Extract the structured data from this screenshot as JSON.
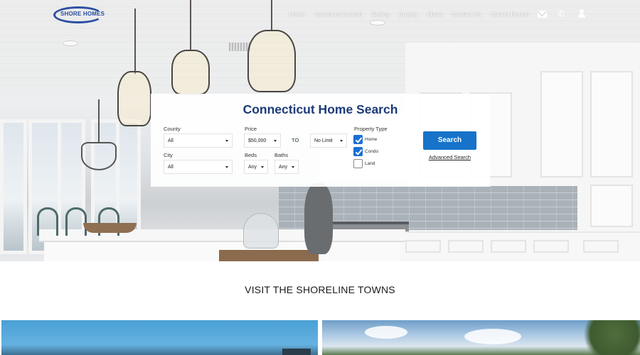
{
  "brand": {
    "logo_text": "SHORE HOMES",
    "accent": "#1c3a78",
    "button_color": "#1673c9"
  },
  "nav": {
    "items": [
      "Home",
      "Advanced Search",
      "Selling",
      "Buying",
      "About",
      "Contact Us",
      "Market Report"
    ],
    "icons": [
      "mail-icon",
      "phone-icon",
      "user-icon"
    ]
  },
  "search": {
    "title": "Connecticut Home Search",
    "county": {
      "label": "County",
      "value": "All"
    },
    "city": {
      "label": "City",
      "value": "All"
    },
    "price": {
      "label": "Price",
      "min_value": "$50,000",
      "to_label": "TO",
      "max_value": "No Limit"
    },
    "beds": {
      "label": "Beds",
      "value": "Any"
    },
    "baths": {
      "label": "Baths",
      "value": "Any"
    },
    "property_type": {
      "label": "Property Type",
      "options": [
        {
          "label": "Home",
          "checked": true
        },
        {
          "label": "Condo",
          "checked": true
        },
        {
          "label": "Land",
          "checked": false
        }
      ]
    },
    "search_button": "Search",
    "advanced_link": "Advanced Search"
  },
  "section": {
    "title": "VISIT THE SHORELINE TOWNS"
  }
}
